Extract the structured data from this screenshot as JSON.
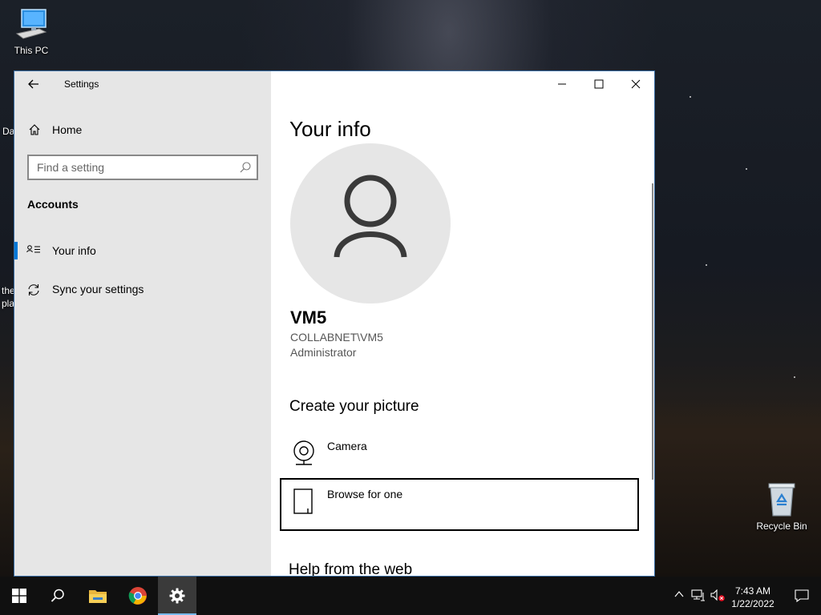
{
  "desktop": {
    "icons": [
      {
        "label": "This PC",
        "icon": "computer-icon"
      },
      {
        "label": "Recycle Bin",
        "icon": "recycle-bin-icon"
      }
    ],
    "edge_text": [
      "Da",
      "the",
      "pla"
    ]
  },
  "window": {
    "app_title": "Settings",
    "caption": {
      "minimize": "minimize-icon",
      "maximize": "maximize-icon",
      "close": "close-icon"
    },
    "nav": {
      "home_label": "Home",
      "search_placeholder": "Find a setting",
      "section_title": "Accounts",
      "items": [
        {
          "label": "Your info",
          "icon": "contact-info-icon",
          "selected": true
        },
        {
          "label": "Sync your settings",
          "icon": "sync-icon",
          "selected": false
        }
      ]
    },
    "content": {
      "page_title": "Your info",
      "user": {
        "name": "VM5",
        "domain_account": "COLLABNET\\VM5",
        "role": "Administrator"
      },
      "create_picture_title": "Create your picture",
      "picture_options": [
        {
          "label": "Camera",
          "icon": "camera-icon"
        },
        {
          "label": "Browse for one",
          "icon": "browse-file-icon"
        }
      ],
      "help_title": "Help from the web"
    },
    "accent_color": "#0078d7"
  },
  "taskbar": {
    "buttons": [
      "windows-start-icon",
      "search-icon",
      "file-explorer-icon",
      "chrome-icon",
      "settings-gear-icon"
    ],
    "clock": {
      "time": "7:43 AM",
      "date": "1/22/2022"
    },
    "tray": [
      "show-hidden-icons-chevron",
      "network-icon",
      "volume-muted-icon",
      "notification-center-icon"
    ]
  }
}
